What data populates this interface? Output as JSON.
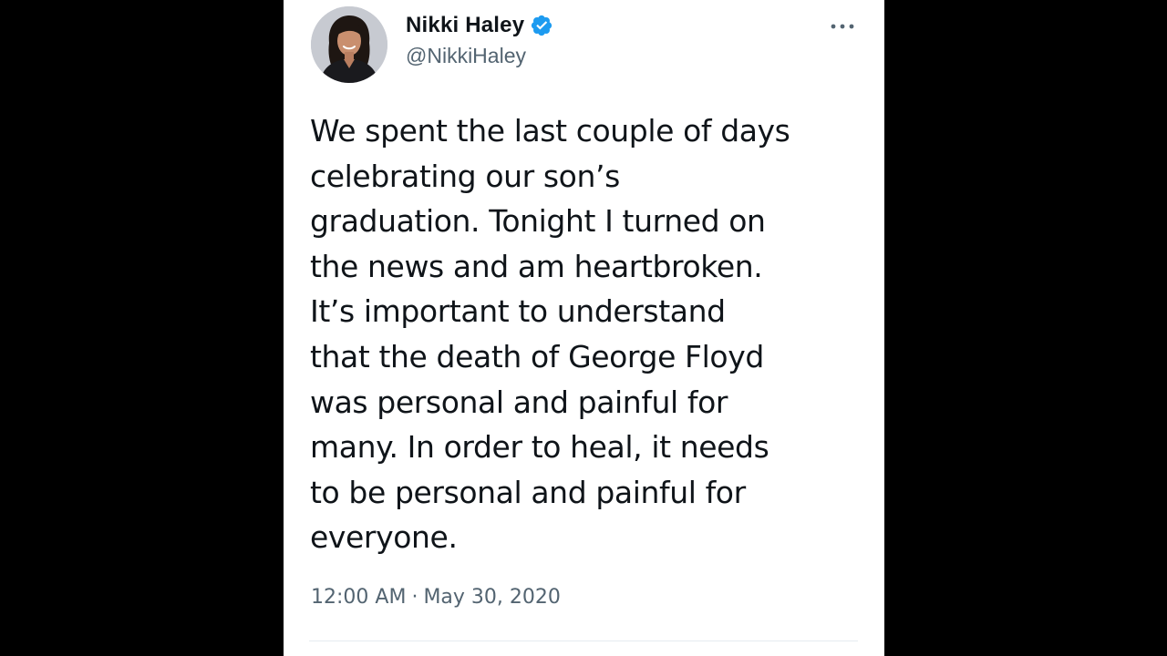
{
  "tweet": {
    "author": {
      "display_name": "Nikki Haley",
      "handle": "@NikkiHaley",
      "verified": true,
      "avatar_icon": "profile-photo"
    },
    "text": "We spent the last couple of days\ncelebrating our son’s\ngraduation. Tonight I turned on\nthe news and am heartbroken.\nIt’s important to understand\nthat the death of George Floyd\nwas personal and painful for\nmany. In order to heal, it needs\nto be personal and painful for\neveryone.",
    "time": "12:00 AM",
    "separator": "·",
    "date": "May 30, 2020",
    "more_icon": "more-horizontal-icon"
  },
  "colors": {
    "background": "#000000",
    "card": "#ffffff",
    "text_primary": "#0f1419",
    "text_secondary": "#536471",
    "verified_badge": "#1d9bf0"
  }
}
